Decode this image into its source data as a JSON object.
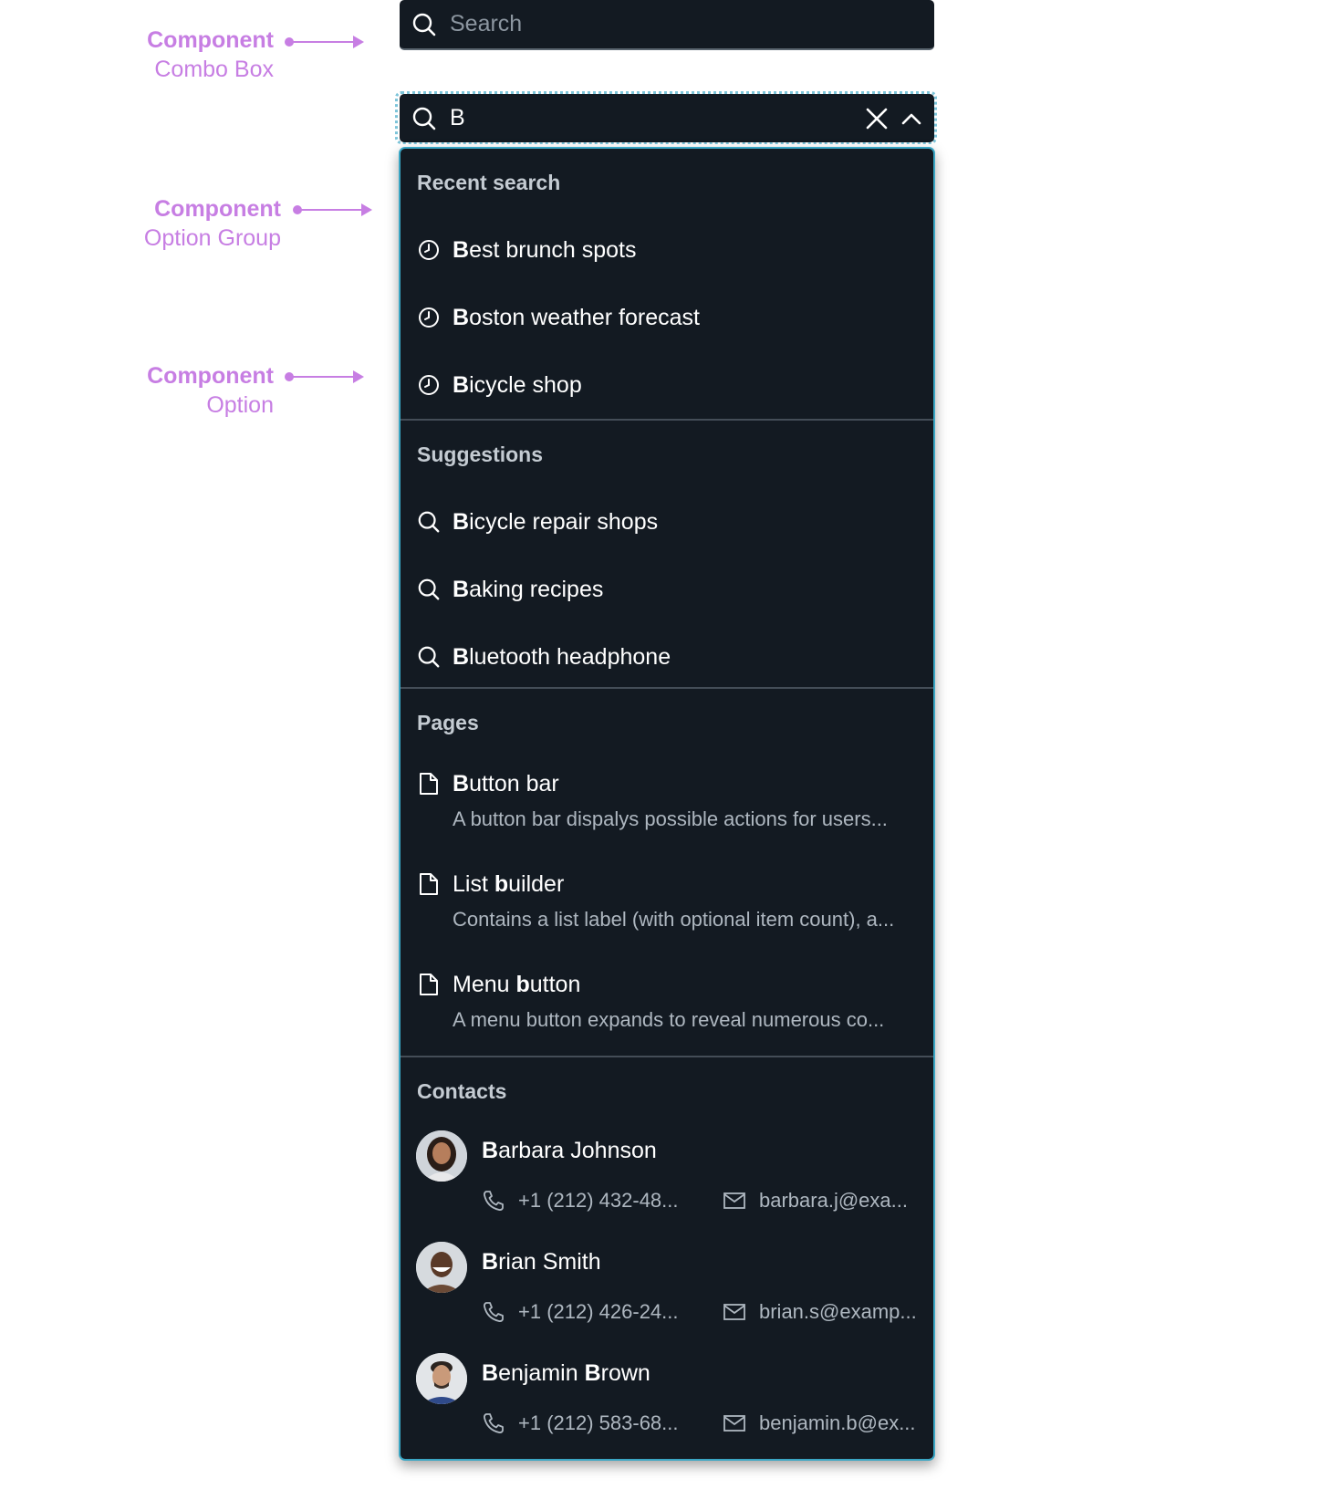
{
  "annotations": [
    {
      "title": "Component",
      "subtitle": "Combo Box"
    },
    {
      "title": "Component",
      "subtitle": "Option Group"
    },
    {
      "title": "Component",
      "subtitle": "Option"
    }
  ],
  "combo_idle": {
    "placeholder": "Search"
  },
  "combo_active": {
    "value": "B"
  },
  "groups": {
    "recent": {
      "label": "Recent search",
      "items": [
        {
          "match": "B",
          "rest": "est brunch spots"
        },
        {
          "match": "B",
          "rest": "oston weather forecast"
        },
        {
          "match": "B",
          "rest": "icycle shop"
        }
      ]
    },
    "suggestions": {
      "label": "Suggestions",
      "items": [
        {
          "match": "B",
          "rest": "icycle repair shops"
        },
        {
          "match": "B",
          "rest": "aking recipes"
        },
        {
          "match": "B",
          "rest": "luetooth headphone"
        }
      ]
    },
    "pages": {
      "label": "Pages",
      "items": [
        {
          "pre": "",
          "match": "B",
          "rest": "utton bar",
          "desc": "A button bar dispalys possible actions for users..."
        },
        {
          "pre": "List ",
          "match": "b",
          "rest": "uilder",
          "desc": "Contains a list label (with optional item count), a..."
        },
        {
          "pre": "Menu ",
          "match": "b",
          "rest": "utton",
          "desc": "A menu button expands to reveal numerous co..."
        }
      ]
    },
    "contacts": {
      "label": "Contacts",
      "items": [
        {
          "match": "B",
          "rest": "arbara Johnson",
          "match2": "",
          "rest2": "",
          "phone": "+1 (212) 432-48...",
          "email": "barbara.j@exa..."
        },
        {
          "match": "B",
          "rest": "rian Smith",
          "match2": "",
          "rest2": "",
          "phone": "+1 (212) 426-24...",
          "email": "brian.s@examp..."
        },
        {
          "match": "B",
          "rest": "enjamin ",
          "match2": "B",
          "rest2": "rown",
          "phone": "+1 (212) 583-68...",
          "email": "benjamin.b@ex..."
        }
      ]
    }
  },
  "colors": {
    "accent": "#c77ee3",
    "surface": "#131a22",
    "focus": "#3aa6c4"
  }
}
